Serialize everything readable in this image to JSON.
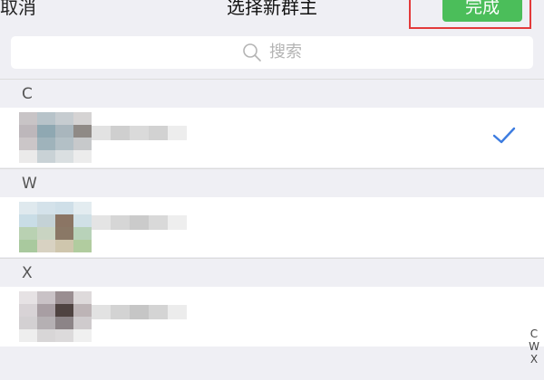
{
  "header": {
    "cancel_label": "取消",
    "title": "选择新群主",
    "done_label": "完成"
  },
  "search": {
    "placeholder": "搜索"
  },
  "sections": [
    {
      "label": "C"
    },
    {
      "label": "W"
    },
    {
      "label": "X"
    }
  ],
  "contacts": [
    {
      "section": "C",
      "selected": true
    },
    {
      "section": "W",
      "selected": false
    },
    {
      "section": "X",
      "selected": false
    }
  ],
  "index_bar": [
    "C",
    "W",
    "X"
  ],
  "colors": {
    "done_button": "#4bbe5a",
    "highlight_border": "#e33a3a",
    "checkmark": "#3d7ce0",
    "background": "#efeff4"
  }
}
